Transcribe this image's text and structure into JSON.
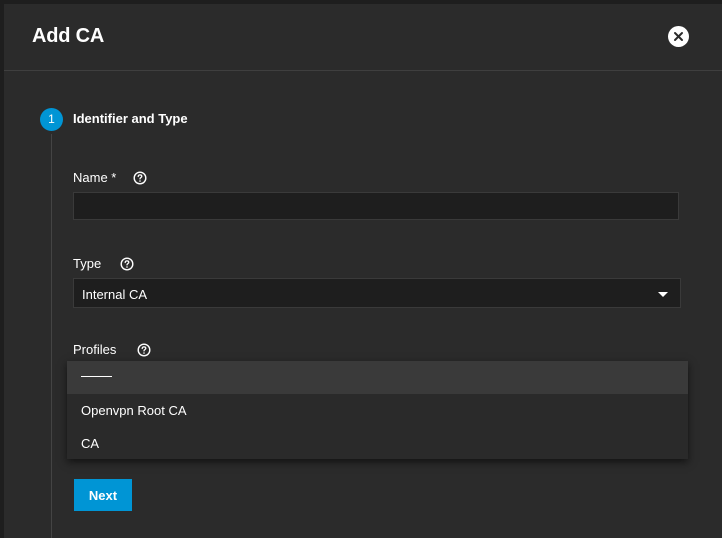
{
  "dialog": {
    "title": "Add CA",
    "close_icon": "close-icon"
  },
  "stepper": {
    "step_number": "1",
    "step_title": "Identifier and Type"
  },
  "form": {
    "name": {
      "label": "Name *",
      "value": "",
      "placeholder": "",
      "help_icon": "help-circle-icon"
    },
    "type": {
      "label": "Type",
      "selected": "Internal CA",
      "help_icon": "help-circle-icon"
    },
    "profiles": {
      "label": "Profiles",
      "help_icon": "help-circle-icon",
      "options": [
        "",
        "Openvpn Root CA",
        "CA"
      ]
    }
  },
  "actions": {
    "next_label": "Next"
  },
  "colors": {
    "accent": "#0095d5",
    "background": "#2b2b2b",
    "input_background": "#1e1e1e"
  }
}
